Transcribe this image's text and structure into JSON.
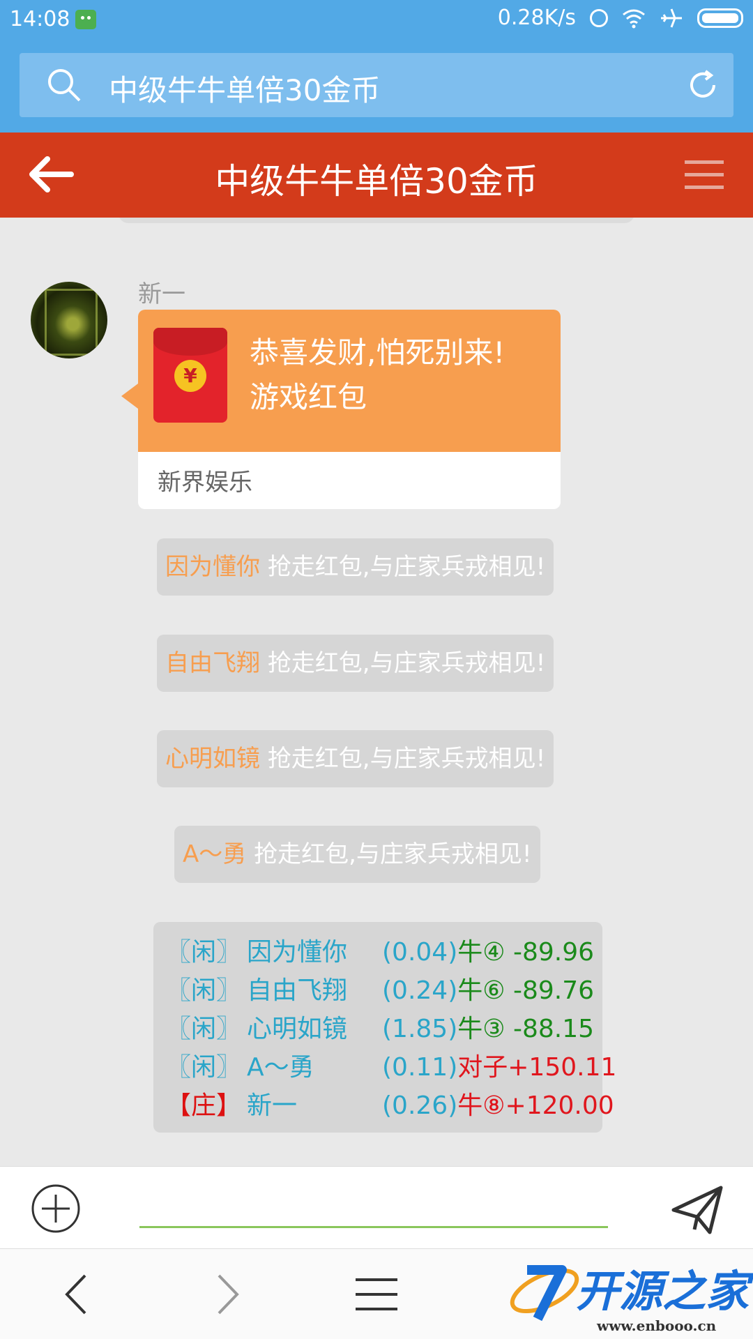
{
  "status_bar": {
    "time": "14:08",
    "net_speed": "0.28K/s",
    "icons": [
      "android-icon",
      "alarm-icon",
      "wifi-icon",
      "airplane-icon",
      "battery-icon"
    ]
  },
  "url_bar": {
    "text": "中级牛牛单倍30金币",
    "icons": [
      "search-icon",
      "refresh-icon"
    ]
  },
  "header": {
    "title": "中级牛牛单倍30金币",
    "icons": [
      "back-arrow-icon",
      "menu-icon"
    ]
  },
  "chat": {
    "red_packet_message": {
      "sender": "新一",
      "title_line1": "恭喜发财,怕死别来!",
      "title_line2": "游戏红包",
      "footer": "新界娱乐",
      "coin_symbol": "¥"
    },
    "system_messages": [
      {
        "user": "因为懂你",
        "text": "抢走红包,与庄家兵戎相见!"
      },
      {
        "user": "自由飞翔",
        "text": "抢走红包,与庄家兵戎相见!"
      },
      {
        "user": "心明如镜",
        "text": "抢走红包,与庄家兵戎相见!"
      },
      {
        "user": "A～勇",
        "text": "抢走红包,与庄家兵戎相见!"
      }
    ],
    "results": [
      {
        "role": "〖闲〗",
        "name": "因为懂你",
        "amount": "(0.04)",
        "hand": "牛④ -89.96",
        "win": false,
        "banker": false
      },
      {
        "role": "〖闲〗",
        "name": "自由飞翔",
        "amount": "(0.24)",
        "hand": "牛⑥ -89.76",
        "win": false,
        "banker": false
      },
      {
        "role": "〖闲〗",
        "name": "心明如镜",
        "amount": "(1.85)",
        "hand": "牛③ -88.15",
        "win": false,
        "banker": false
      },
      {
        "role": "〖闲〗",
        "name": "A～勇",
        "amount": "(0.11)",
        "hand": "对子+150.11",
        "win": true,
        "banker": false
      },
      {
        "role": "【庄】",
        "name": "新一",
        "amount": "(0.26)",
        "hand": "牛⑧+120.00",
        "win": true,
        "banker": true
      }
    ]
  },
  "input_bar": {
    "placeholder": "",
    "icons": [
      "plus-icon",
      "send-icon"
    ]
  },
  "bottom_bar": {
    "icons": [
      "nav-back-icon",
      "nav-forward-icon",
      "nav-menu-icon"
    ],
    "watermark_text": "开源之家",
    "watermark_url": "www.enbooo.cn"
  },
  "colors": {
    "status_blue": "#52a9e6",
    "header_red": "#d33b1b",
    "packet_orange": "#f79e4f",
    "teal_text": "#2aa5c9",
    "loss_green": "#1b8a1b",
    "win_red": "#e0161d"
  }
}
